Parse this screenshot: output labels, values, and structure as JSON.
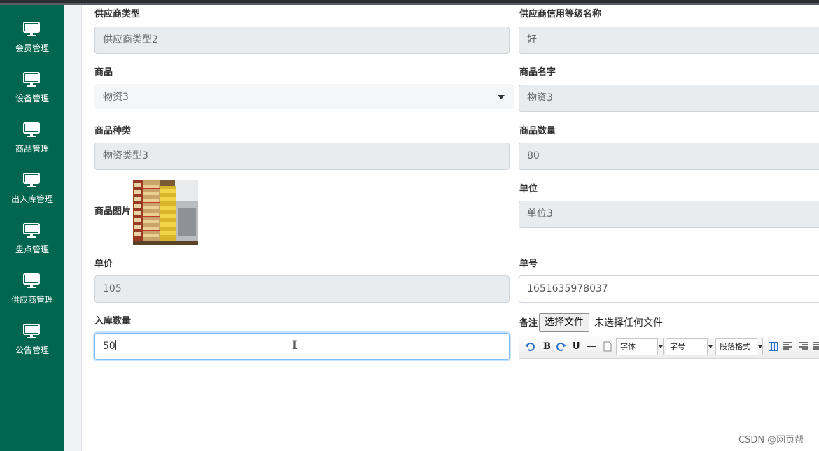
{
  "sidebar": {
    "items": [
      {
        "label": "会员管理",
        "icon": "monitor-icon"
      },
      {
        "label": "设备管理",
        "icon": "monitor-icon"
      },
      {
        "label": "商品管理",
        "icon": "monitor-icon"
      },
      {
        "label": "出入库管理",
        "icon": "monitor-icon"
      },
      {
        "label": "盘点管理",
        "icon": "monitor-icon"
      },
      {
        "label": "供应商管理",
        "icon": "monitor-icon"
      },
      {
        "label": "公告管理",
        "icon": "monitor-icon"
      }
    ]
  },
  "form": {
    "supplier_type": {
      "label": "供应商类型",
      "value": "供应商类型2"
    },
    "supplier_credit": {
      "label": "供应商信用等级名称",
      "value": "好"
    },
    "goods": {
      "label": "商品",
      "value": "物资3"
    },
    "goods_name": {
      "label": "商品名字",
      "value": "物资3"
    },
    "goods_category": {
      "label": "商品种类",
      "value": "物资类型3"
    },
    "goods_quantity": {
      "label": "商品数量",
      "value": "80"
    },
    "goods_image": {
      "label": "商品图片"
    },
    "unit": {
      "label": "单位",
      "value": "单位3"
    },
    "unit_price": {
      "label": "单价",
      "value": "105"
    },
    "order_no": {
      "label": "单号",
      "value": "1651635978037"
    },
    "inbound_qty": {
      "label": "入库数量",
      "value": "50"
    },
    "remark": {
      "label": "备注",
      "file_button": "选择文件",
      "file_status": "未选择任何文件"
    }
  },
  "editor_toolbar": {
    "bold": "B",
    "underline": "U",
    "font_family": "字体",
    "font_size": "字号",
    "paragraph": "段落格式"
  },
  "watermark": "CSDN @网页帮",
  "colors": {
    "sidebar": "#00664f",
    "input_readonly": "#e9ecef",
    "focus_border": "#80bdff"
  }
}
